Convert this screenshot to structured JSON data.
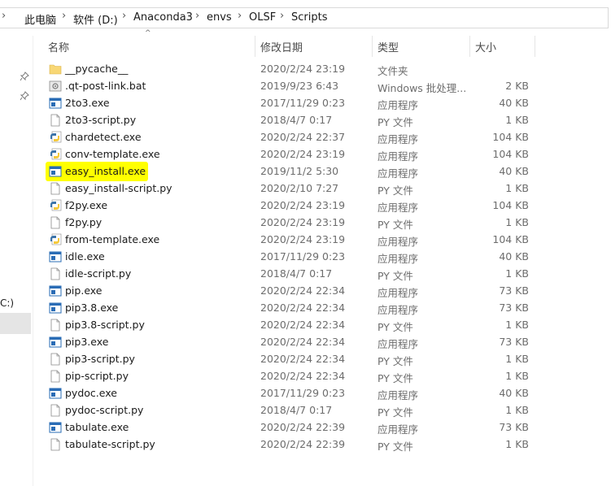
{
  "breadcrumb": [
    "此电脑",
    "软件 (D:)",
    "Anaconda3",
    "envs",
    "OLSF",
    "Scripts"
  ],
  "nav_label": "C:)",
  "columns": {
    "name": "名称",
    "date": "修改日期",
    "type": "类型",
    "size": "大小"
  },
  "files": [
    {
      "name": "__pycache__",
      "date": "2020/2/24 23:19",
      "type": "文件夹",
      "size": "",
      "icon": "folder-icon"
    },
    {
      "name": ".qt-post-link.bat",
      "date": "2019/9/23 6:43",
      "type": "Windows 批处理...",
      "size": "2 KB",
      "icon": "batch-file-icon"
    },
    {
      "name": "2to3.exe",
      "date": "2017/11/29 0:23",
      "type": "应用程序",
      "size": "40 KB",
      "icon": "exe-icon"
    },
    {
      "name": "2to3-script.py",
      "date": "2018/4/7 0:17",
      "type": "PY 文件",
      "size": "1 KB",
      "icon": "file-icon"
    },
    {
      "name": "chardetect.exe",
      "date": "2020/2/24 22:37",
      "type": "应用程序",
      "size": "104 KB",
      "icon": "python-exe-icon"
    },
    {
      "name": "conv-template.exe",
      "date": "2020/2/24 23:19",
      "type": "应用程序",
      "size": "104 KB",
      "icon": "python-exe-icon"
    },
    {
      "name": "easy_install.exe",
      "date": "2019/11/2 5:30",
      "type": "应用程序",
      "size": "40 KB",
      "icon": "exe-icon",
      "highlight": true
    },
    {
      "name": "easy_install-script.py",
      "date": "2020/2/10 7:27",
      "type": "PY 文件",
      "size": "1 KB",
      "icon": "file-icon"
    },
    {
      "name": "f2py.exe",
      "date": "2020/2/24 23:19",
      "type": "应用程序",
      "size": "104 KB",
      "icon": "python-exe-icon"
    },
    {
      "name": "f2py.py",
      "date": "2020/2/24 23:19",
      "type": "PY 文件",
      "size": "1 KB",
      "icon": "file-icon"
    },
    {
      "name": "from-template.exe",
      "date": "2020/2/24 23:19",
      "type": "应用程序",
      "size": "104 KB",
      "icon": "python-exe-icon"
    },
    {
      "name": "idle.exe",
      "date": "2017/11/29 0:23",
      "type": "应用程序",
      "size": "40 KB",
      "icon": "exe-icon"
    },
    {
      "name": "idle-script.py",
      "date": "2018/4/7 0:17",
      "type": "PY 文件",
      "size": "1 KB",
      "icon": "file-icon"
    },
    {
      "name": "pip.exe",
      "date": "2020/2/24 22:34",
      "type": "应用程序",
      "size": "73 KB",
      "icon": "exe-icon"
    },
    {
      "name": "pip3.8.exe",
      "date": "2020/2/24 22:34",
      "type": "应用程序",
      "size": "73 KB",
      "icon": "exe-icon"
    },
    {
      "name": "pip3.8-script.py",
      "date": "2020/2/24 22:34",
      "type": "PY 文件",
      "size": "1 KB",
      "icon": "file-icon"
    },
    {
      "name": "pip3.exe",
      "date": "2020/2/24 22:34",
      "type": "应用程序",
      "size": "73 KB",
      "icon": "exe-icon"
    },
    {
      "name": "pip3-script.py",
      "date": "2020/2/24 22:34",
      "type": "PY 文件",
      "size": "1 KB",
      "icon": "file-icon"
    },
    {
      "name": "pip-script.py",
      "date": "2020/2/24 22:34",
      "type": "PY 文件",
      "size": "1 KB",
      "icon": "file-icon"
    },
    {
      "name": "pydoc.exe",
      "date": "2017/11/29 0:23",
      "type": "应用程序",
      "size": "40 KB",
      "icon": "exe-icon"
    },
    {
      "name": "pydoc-script.py",
      "date": "2018/4/7 0:17",
      "type": "PY 文件",
      "size": "1 KB",
      "icon": "file-icon"
    },
    {
      "name": "tabulate.exe",
      "date": "2020/2/24 22:39",
      "type": "应用程序",
      "size": "73 KB",
      "icon": "exe-icon"
    },
    {
      "name": "tabulate-script.py",
      "date": "2020/2/24 22:39",
      "type": "PY 文件",
      "size": "1 KB",
      "icon": "file-icon"
    }
  ],
  "colors": {
    "highlight": "#ffff00",
    "folder": "#f8d775",
    "exe": "#2a6cb5"
  }
}
